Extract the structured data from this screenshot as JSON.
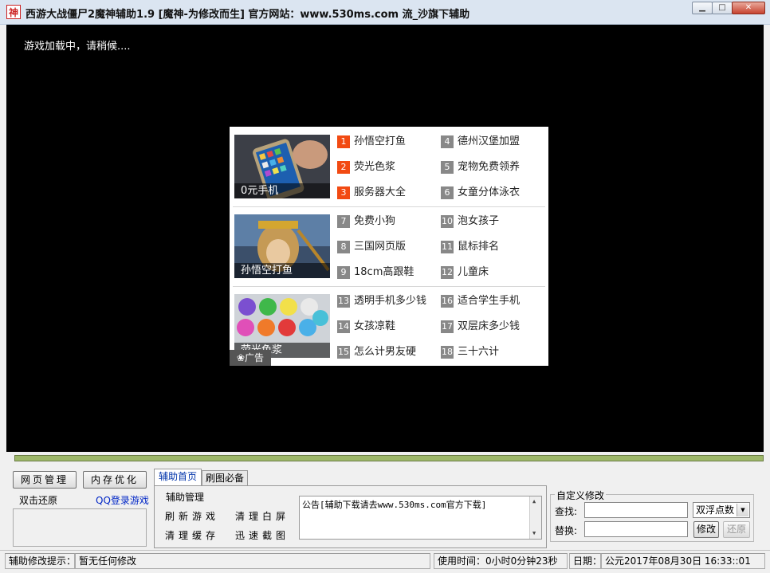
{
  "window": {
    "icon_glyph": "神",
    "title": "西游大战僵尸2魔神辅助1.9    [魔神-为修改而生]   官方网站：www.530ms.com 流_沙旗下辅助"
  },
  "game": {
    "loading_text": "游戏加载中，请稍候....",
    "ad": {
      "tag": "广告",
      "groups": [
        {
          "caption": "0元手机",
          "links": [
            {
              "num": "1",
              "text": "孙悟空打鱼",
              "hot": true
            },
            {
              "num": "4",
              "text": "德州汉堡加盟",
              "hot": false
            },
            {
              "num": "2",
              "text": "荧光色浆",
              "hot": true
            },
            {
              "num": "5",
              "text": "宠物免费领养",
              "hot": false
            },
            {
              "num": "3",
              "text": "服务器大全",
              "hot": true
            },
            {
              "num": "6",
              "text": "女童分体泳衣",
              "hot": false
            }
          ]
        },
        {
          "caption": "孙悟空打鱼",
          "links": [
            {
              "num": "7",
              "text": "免费小狗",
              "hot": false
            },
            {
              "num": "10",
              "text": "泡女孩子",
              "hot": false
            },
            {
              "num": "8",
              "text": "三国网页版",
              "hot": false
            },
            {
              "num": "11",
              "text": "鼠标排名",
              "hot": false
            },
            {
              "num": "9",
              "text": "18cm高跟鞋",
              "hot": false
            },
            {
              "num": "12",
              "text": "儿童床",
              "hot": false
            }
          ]
        },
        {
          "caption": "荧光色浆",
          "links": [
            {
              "num": "13",
              "text": "透明手机多少钱",
              "hot": false
            },
            {
              "num": "16",
              "text": "适合学生手机",
              "hot": false
            },
            {
              "num": "14",
              "text": "女孩凉鞋",
              "hot": false
            },
            {
              "num": "17",
              "text": "双层床多少钱",
              "hot": false
            },
            {
              "num": "15",
              "text": "怎么计男友硬",
              "hot": false
            },
            {
              "num": "18",
              "text": "三十六计",
              "hot": false
            }
          ]
        }
      ]
    }
  },
  "left_panel": {
    "web_manage": "网页管理",
    "mem_optimize": "内存优化",
    "dblclick_restore": "双击还原",
    "qq_login": "QQ登录游戏"
  },
  "tabs": [
    {
      "label": "辅助首页",
      "active": true
    },
    {
      "label": "刷图必备",
      "active": false
    }
  ],
  "assist": {
    "group_title": "辅助管理",
    "refresh_game": "刷新游戏",
    "clear_white": "清理白屏",
    "clear_cache": "清理缓存",
    "quick_shot": "迅速截图",
    "notice": "公告[辅助下载请去www.530ms.com官方下载]"
  },
  "custom": {
    "title": "自定义修改",
    "find_label": "查找:",
    "replace_label": "替换:",
    "select_value": "双浮点数",
    "modify": "修改",
    "restore": "还原"
  },
  "status": {
    "hint_label": "辅助修改提示：",
    "hint_value": "暂无任何修改",
    "usage": "使用时间：0小时0分钟23秒",
    "date_label": "日期：",
    "date_value": "公元2017年08月30日 16:33::01"
  }
}
